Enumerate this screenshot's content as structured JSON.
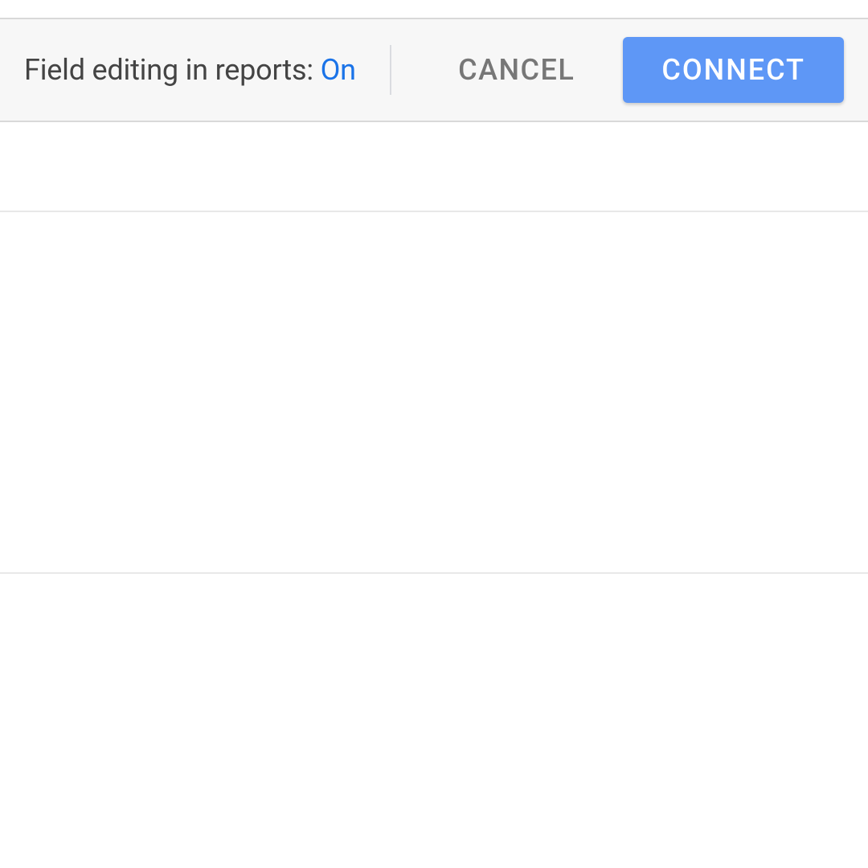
{
  "header": {
    "field_editing_label": "Field editing in reports: ",
    "field_editing_status": "On",
    "cancel_label": "CANCEL",
    "connect_label": "CONNECT"
  }
}
